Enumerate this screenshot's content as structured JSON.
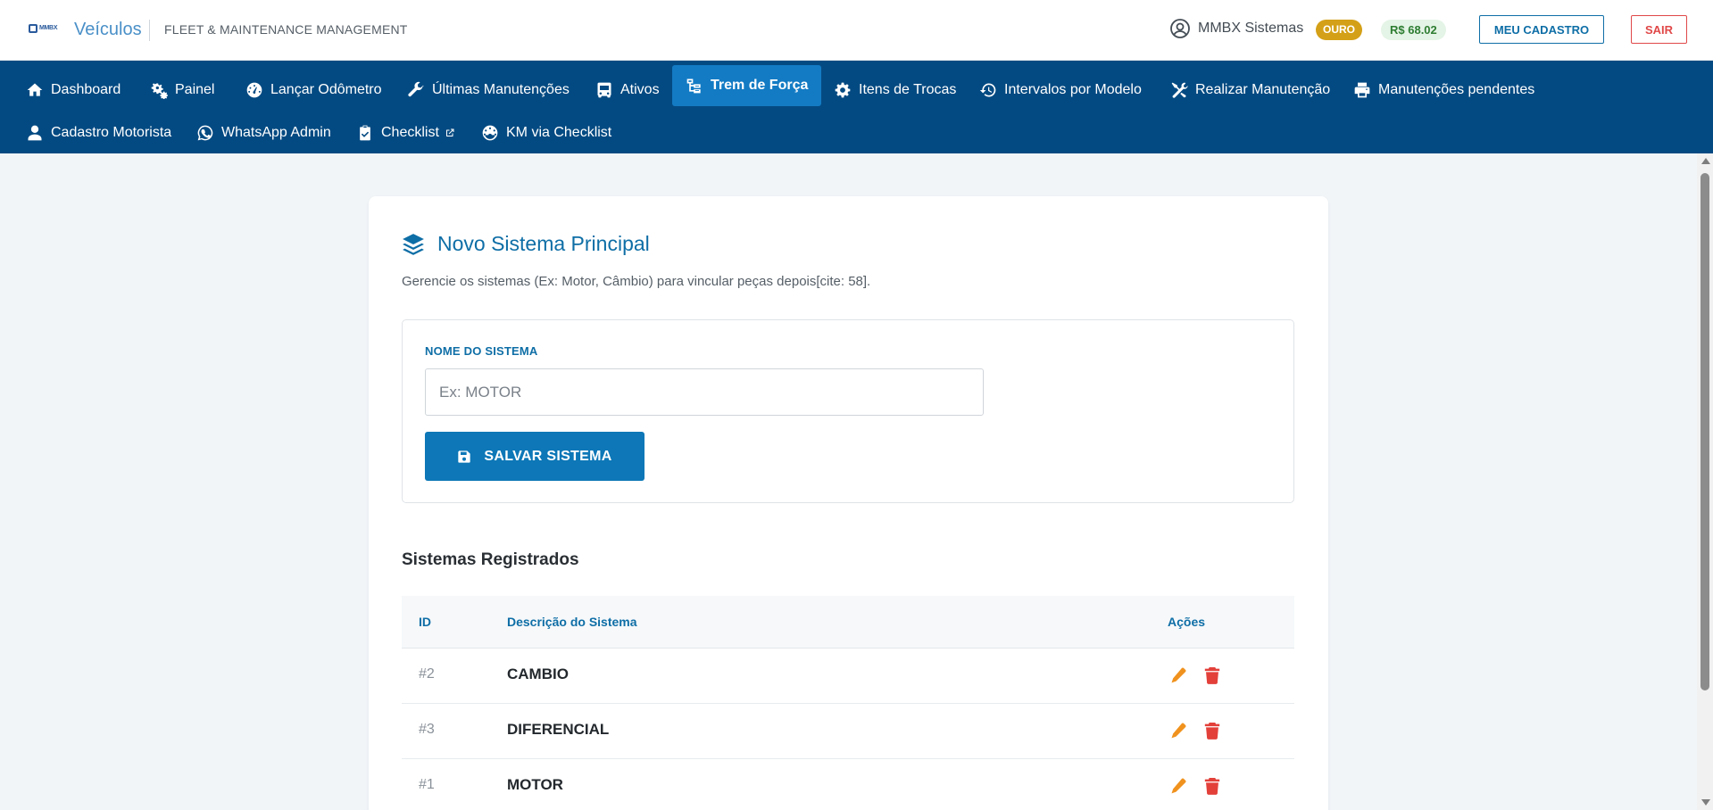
{
  "header": {
    "logo_text": "MMBX",
    "brand": "Veículos",
    "subtitle": "FLEET & MAINTENANCE MANAGEMENT",
    "user_name": "MMBX Sistemas",
    "plan_badge": "OURO",
    "balance": "R$ 68.02",
    "profile_button": "MEU CADASTRO",
    "logout_button": "SAIR"
  },
  "nav": {
    "items": [
      {
        "label": "Dashboard",
        "icon": "home-icon"
      },
      {
        "label": "Painel",
        "icon": "cogs-icon"
      },
      {
        "label": "Lançar Odômetro",
        "icon": "gauge-icon"
      },
      {
        "label": "Últimas Manutenções",
        "icon": "wrench-icon"
      },
      {
        "label": "Ativos",
        "icon": "bus-icon"
      },
      {
        "label": "Trem de Força",
        "icon": "sitemap-icon",
        "active": true
      },
      {
        "label": "Itens de Trocas",
        "icon": "gear-icon"
      },
      {
        "label": "Intervalos por Modelo",
        "icon": "history-icon"
      },
      {
        "label": "Realizar Manutenção",
        "icon": "tools-icon"
      },
      {
        "label": "Manutenções pendentes",
        "icon": "print-icon"
      },
      {
        "label": "Cadastro Motorista",
        "icon": "user-icon"
      },
      {
        "label": "WhatsApp Admin",
        "icon": "whatsapp-icon"
      },
      {
        "label": "Checklist",
        "icon": "clipboard-icon"
      },
      {
        "label": "KM via Checklist",
        "icon": "dashboard-icon"
      }
    ]
  },
  "main": {
    "title": "Novo Sistema Principal",
    "description": "Gerencie os sistemas (Ex: Motor, Câmbio) para vincular peças depois[cite: 58].",
    "form": {
      "label": "NOME DO SISTEMA",
      "placeholder": "Ex: MOTOR",
      "value": "",
      "save_button": "SALVAR SISTEMA"
    },
    "table_title": "Sistemas Registrados",
    "table": {
      "headers": [
        "ID",
        "Descrição do Sistema",
        "Ações"
      ],
      "rows": [
        {
          "id": "#2",
          "description": "CAMBIO"
        },
        {
          "id": "#3",
          "description": "DIFERENCIAL"
        },
        {
          "id": "#1",
          "description": "MOTOR"
        }
      ]
    }
  },
  "colors": {
    "nav_bg": "#044a82",
    "nav_active": "#137bc4",
    "accent": "#0e6ea6",
    "edit": "#f0921e",
    "delete": "#e3403a",
    "badge_gold": "#d4a017",
    "balance_green": "#2e7d32"
  }
}
